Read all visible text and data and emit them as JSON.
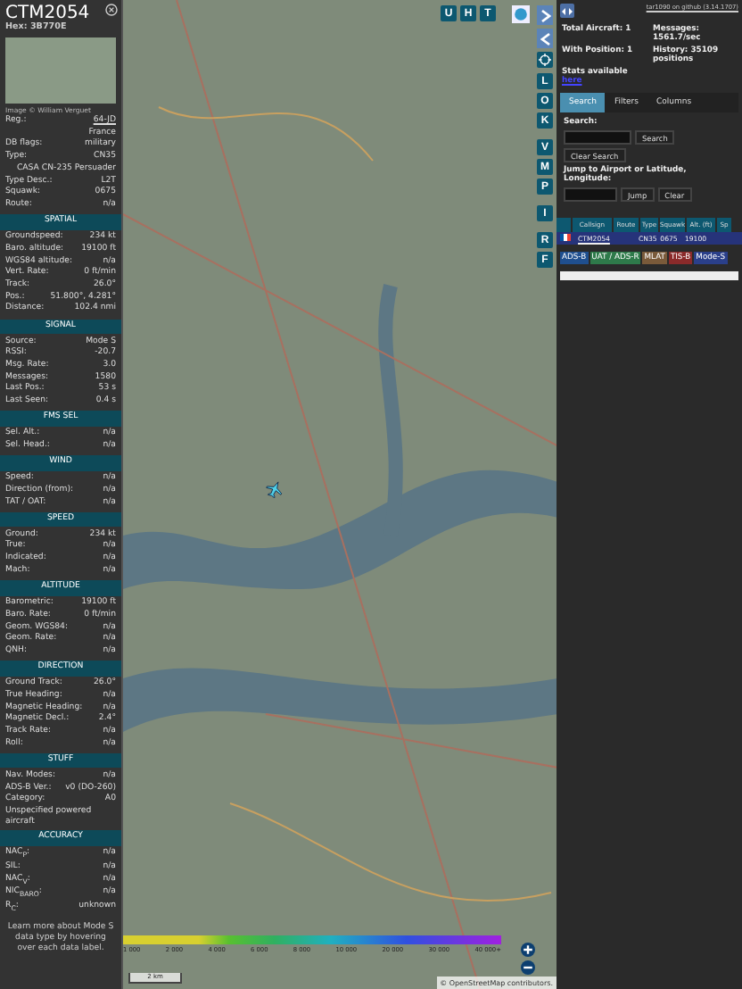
{
  "aircraft": {
    "callsign": "CTM2054",
    "hex_label": "Hex:",
    "hex": "3B770E",
    "photo_credit": "Image © William Verguet",
    "sections": [
      {
        "rows": [
          {
            "kind": "link",
            "label": "Reg.:",
            "value": "64-JD"
          },
          {
            "kind": "value",
            "value": "France"
          },
          {
            "kind": "pair",
            "label": "DB flags:",
            "value": "military"
          },
          {
            "kind": "pair",
            "label": "Type:",
            "value": "CN35"
          },
          {
            "kind": "value",
            "value": "CASA CN-235 Persuader"
          },
          {
            "kind": "pair",
            "label": "Type Desc.:",
            "value": "L2T"
          },
          {
            "kind": "pair",
            "label": "Squawk:",
            "value": "0675"
          },
          {
            "kind": "pair",
            "label": "Route:",
            "value": "n/a"
          }
        ]
      },
      {
        "title": "SPATIAL",
        "rows": [
          {
            "kind": "pair",
            "label": "Groundspeed:",
            "value": "234 kt"
          },
          {
            "kind": "pair",
            "label": "Baro. altitude:",
            "value": "19100 ft"
          },
          {
            "kind": "pair",
            "label": "WGS84 altitude:",
            "value": "n/a"
          },
          {
            "kind": "pair",
            "label": "Vert. Rate:",
            "value": "0 ft/min"
          },
          {
            "kind": "pair",
            "label": "Track:",
            "value": "26.0°"
          },
          {
            "kind": "pair",
            "label": "Pos.:",
            "value": "51.800°, 4.281°"
          },
          {
            "kind": "pair",
            "label": "Distance:",
            "value": "102.4 nmi"
          }
        ]
      },
      {
        "title": "SIGNAL",
        "rows": [
          {
            "kind": "pair",
            "label": "Source:",
            "value": "Mode S"
          },
          {
            "kind": "pair",
            "label": "RSSI:",
            "value": "-20.7"
          },
          {
            "kind": "pair",
            "label": "Msg. Rate:",
            "value": "3.0"
          },
          {
            "kind": "pair",
            "label": "Messages:",
            "value": "1580"
          },
          {
            "kind": "pair",
            "label": "Last Pos.:",
            "value": "53 s"
          },
          {
            "kind": "pair",
            "label": "Last Seen:",
            "value": "0.4 s"
          }
        ]
      },
      {
        "title": "FMS SEL",
        "rows": [
          {
            "kind": "pair",
            "label": "Sel. Alt.:",
            "value": "n/a"
          },
          {
            "kind": "pair",
            "label": "Sel. Head.:",
            "value": "n/a"
          }
        ]
      },
      {
        "title": "WIND",
        "rows": [
          {
            "kind": "pair",
            "label": "Speed:",
            "value": "n/a"
          },
          {
            "kind": "pair",
            "label": "Direction (from):",
            "value": "n/a"
          },
          {
            "kind": "pair",
            "label": "TAT / OAT:",
            "value": "n/a"
          }
        ]
      },
      {
        "title": "SPEED",
        "rows": [
          {
            "kind": "pair",
            "label": "Ground:",
            "value": "234 kt"
          },
          {
            "kind": "pair",
            "label": "True:",
            "value": "n/a"
          },
          {
            "kind": "pair",
            "label": "Indicated:",
            "value": "n/a"
          },
          {
            "kind": "pair",
            "label": "Mach:",
            "value": "n/a"
          }
        ]
      },
      {
        "title": "ALTITUDE",
        "rows": [
          {
            "kind": "pair",
            "label": "Barometric:",
            "value": "19100 ft"
          },
          {
            "kind": "pair",
            "label": "Baro. Rate:",
            "value": "0 ft/min"
          },
          {
            "kind": "pair",
            "label": "Geom. WGS84:",
            "value": "n/a"
          },
          {
            "kind": "pair",
            "label": "Geom. Rate:",
            "value": "n/a"
          },
          {
            "kind": "pair",
            "label": "QNH:",
            "value": "n/a"
          }
        ]
      },
      {
        "title": "DIRECTION",
        "rows": [
          {
            "kind": "pair",
            "label": "Ground Track:",
            "value": "26.0°"
          },
          {
            "kind": "pair",
            "label": "True Heading:",
            "value": "n/a"
          },
          {
            "kind": "pair",
            "label": "Magnetic Heading:",
            "value": "n/a"
          },
          {
            "kind": "pair",
            "label": "Magnetic Decl.:",
            "value": "2.4°"
          },
          {
            "kind": "pair",
            "label": "Track Rate:",
            "value": "n/a"
          },
          {
            "kind": "pair",
            "label": "Roll:",
            "value": "n/a"
          }
        ]
      },
      {
        "title": "STUFF",
        "rows": [
          {
            "kind": "pair",
            "label": "Nav. Modes:",
            "value": "n/a"
          },
          {
            "kind": "pair",
            "label": "ADS-B Ver.:",
            "value": "v0 (DO-260)"
          },
          {
            "kind": "pair",
            "label": "Category:",
            "value": "A0"
          },
          {
            "kind": "note",
            "value": "Unspecified powered aircraft"
          }
        ]
      },
      {
        "title": "ACCURACY",
        "rows": [
          {
            "kind": "pair",
            "label": "NAC$_{P}$:",
            "value": "n/a"
          },
          {
            "kind": "pair",
            "label": "SIL:",
            "value": "n/a"
          },
          {
            "kind": "pair",
            "label": "NAC$_{V}$:",
            "value": "n/a"
          },
          {
            "kind": "pair",
            "label": "NIC$_{BARO}$:",
            "value": "n/a"
          },
          {
            "kind": "pair",
            "label": "R$_{C}$:",
            "value": "unknown"
          }
        ]
      }
    ],
    "footer": "Learn more about Mode S data type by hovering over each data label."
  },
  "map": {
    "top_buttons": [
      "U",
      "H",
      "T"
    ],
    "side_buttons": [
      "L",
      "O",
      "K",
      "V",
      "M",
      "P",
      "I",
      "R",
      "F"
    ],
    "legend_ticks": [
      "1 000",
      "2 000",
      "4 000",
      "6 000",
      "8 000",
      "10 000",
      "20 000",
      "30 000",
      "40 000+"
    ],
    "scale": "2 km",
    "attribution": "© OpenStreetMap contributors."
  },
  "panel": {
    "version_link": "tar1090 on github (3.14.1707)",
    "stats": [
      {
        "label": "Total Aircraft: 1"
      },
      {
        "label": "Messages: 1561.7/sec"
      },
      {
        "label": "With Position: 1"
      },
      {
        "label": "History: 35109 positions"
      }
    ],
    "stats_note": "Stats available",
    "stats_link": "here",
    "tabs": [
      {
        "label": "Search",
        "selected": true
      },
      {
        "label": "Filters",
        "selected": false
      },
      {
        "label": "Columns",
        "selected": false
      }
    ],
    "search_label": "Search:",
    "search_button": "Search",
    "clear_search_button": "Clear Search",
    "jump_label": "Jump to Airport or Latitude, Longitude:",
    "jump_button": "Jump",
    "clear_button": "Clear",
    "table": {
      "columns": [
        "Callsign",
        "Route",
        "Type",
        "Squawk",
        "Alt. (ft)",
        "Sp"
      ],
      "rows": [
        {
          "selected": true,
          "cells": [
            "CTM2054",
            null,
            "CN35",
            "0675",
            "19100"
          ]
        }
      ]
    },
    "sources": [
      {
        "label": "ADS-B",
        "color": "#1f4f8f"
      },
      {
        "label": "UAT / ADS-R",
        "color": "#2e7a4a"
      },
      {
        "label": "MLAT",
        "color": "#7a5a3a"
      },
      {
        "label": "TIS-B",
        "color": "#8a2a2a"
      },
      {
        "label": "Mode-S",
        "color": "#2a3f8a"
      }
    ]
  }
}
